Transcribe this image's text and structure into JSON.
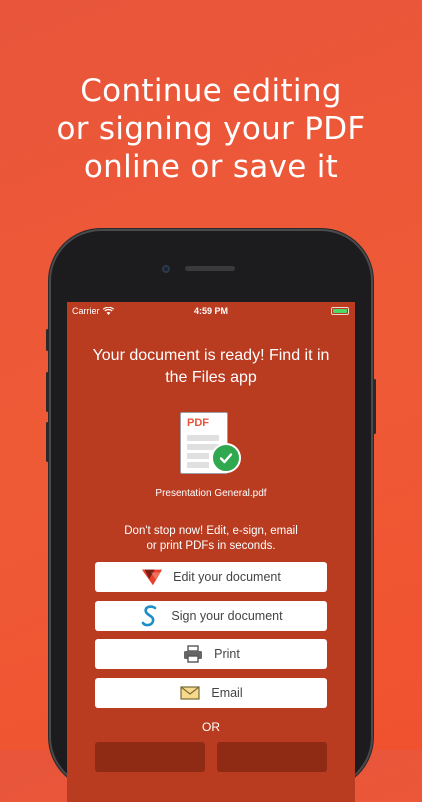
{
  "headline": {
    "line1": "Continue editing",
    "line2": "or signing your PDF",
    "line3": "online or save it"
  },
  "statusbar": {
    "carrier": "Carrier",
    "time": "4:59 PM"
  },
  "screen": {
    "ready_line1": "Your document is ready! Find it in",
    "ready_line2": "the Files app",
    "doc_icon_label": "PDF",
    "filename": "Presentation General.pdf",
    "promo_line1": "Don't stop now! Edit, e-sign, email",
    "promo_line2": "or print PDFs in seconds.",
    "or_label": "OR"
  },
  "actions": [
    {
      "label": "Edit your document",
      "icon": "edit-logo-icon"
    },
    {
      "label": "Sign your document",
      "icon": "sign-logo-icon"
    },
    {
      "label": "Print",
      "icon": "printer-icon"
    },
    {
      "label": "Email",
      "icon": "envelope-icon"
    }
  ],
  "colors": {
    "background": "#ef5a36",
    "screen": "#b93b20",
    "accent_green": "#2fa84f",
    "edit_red": "#e8402a",
    "sign_blue": "#1e8ec9"
  }
}
